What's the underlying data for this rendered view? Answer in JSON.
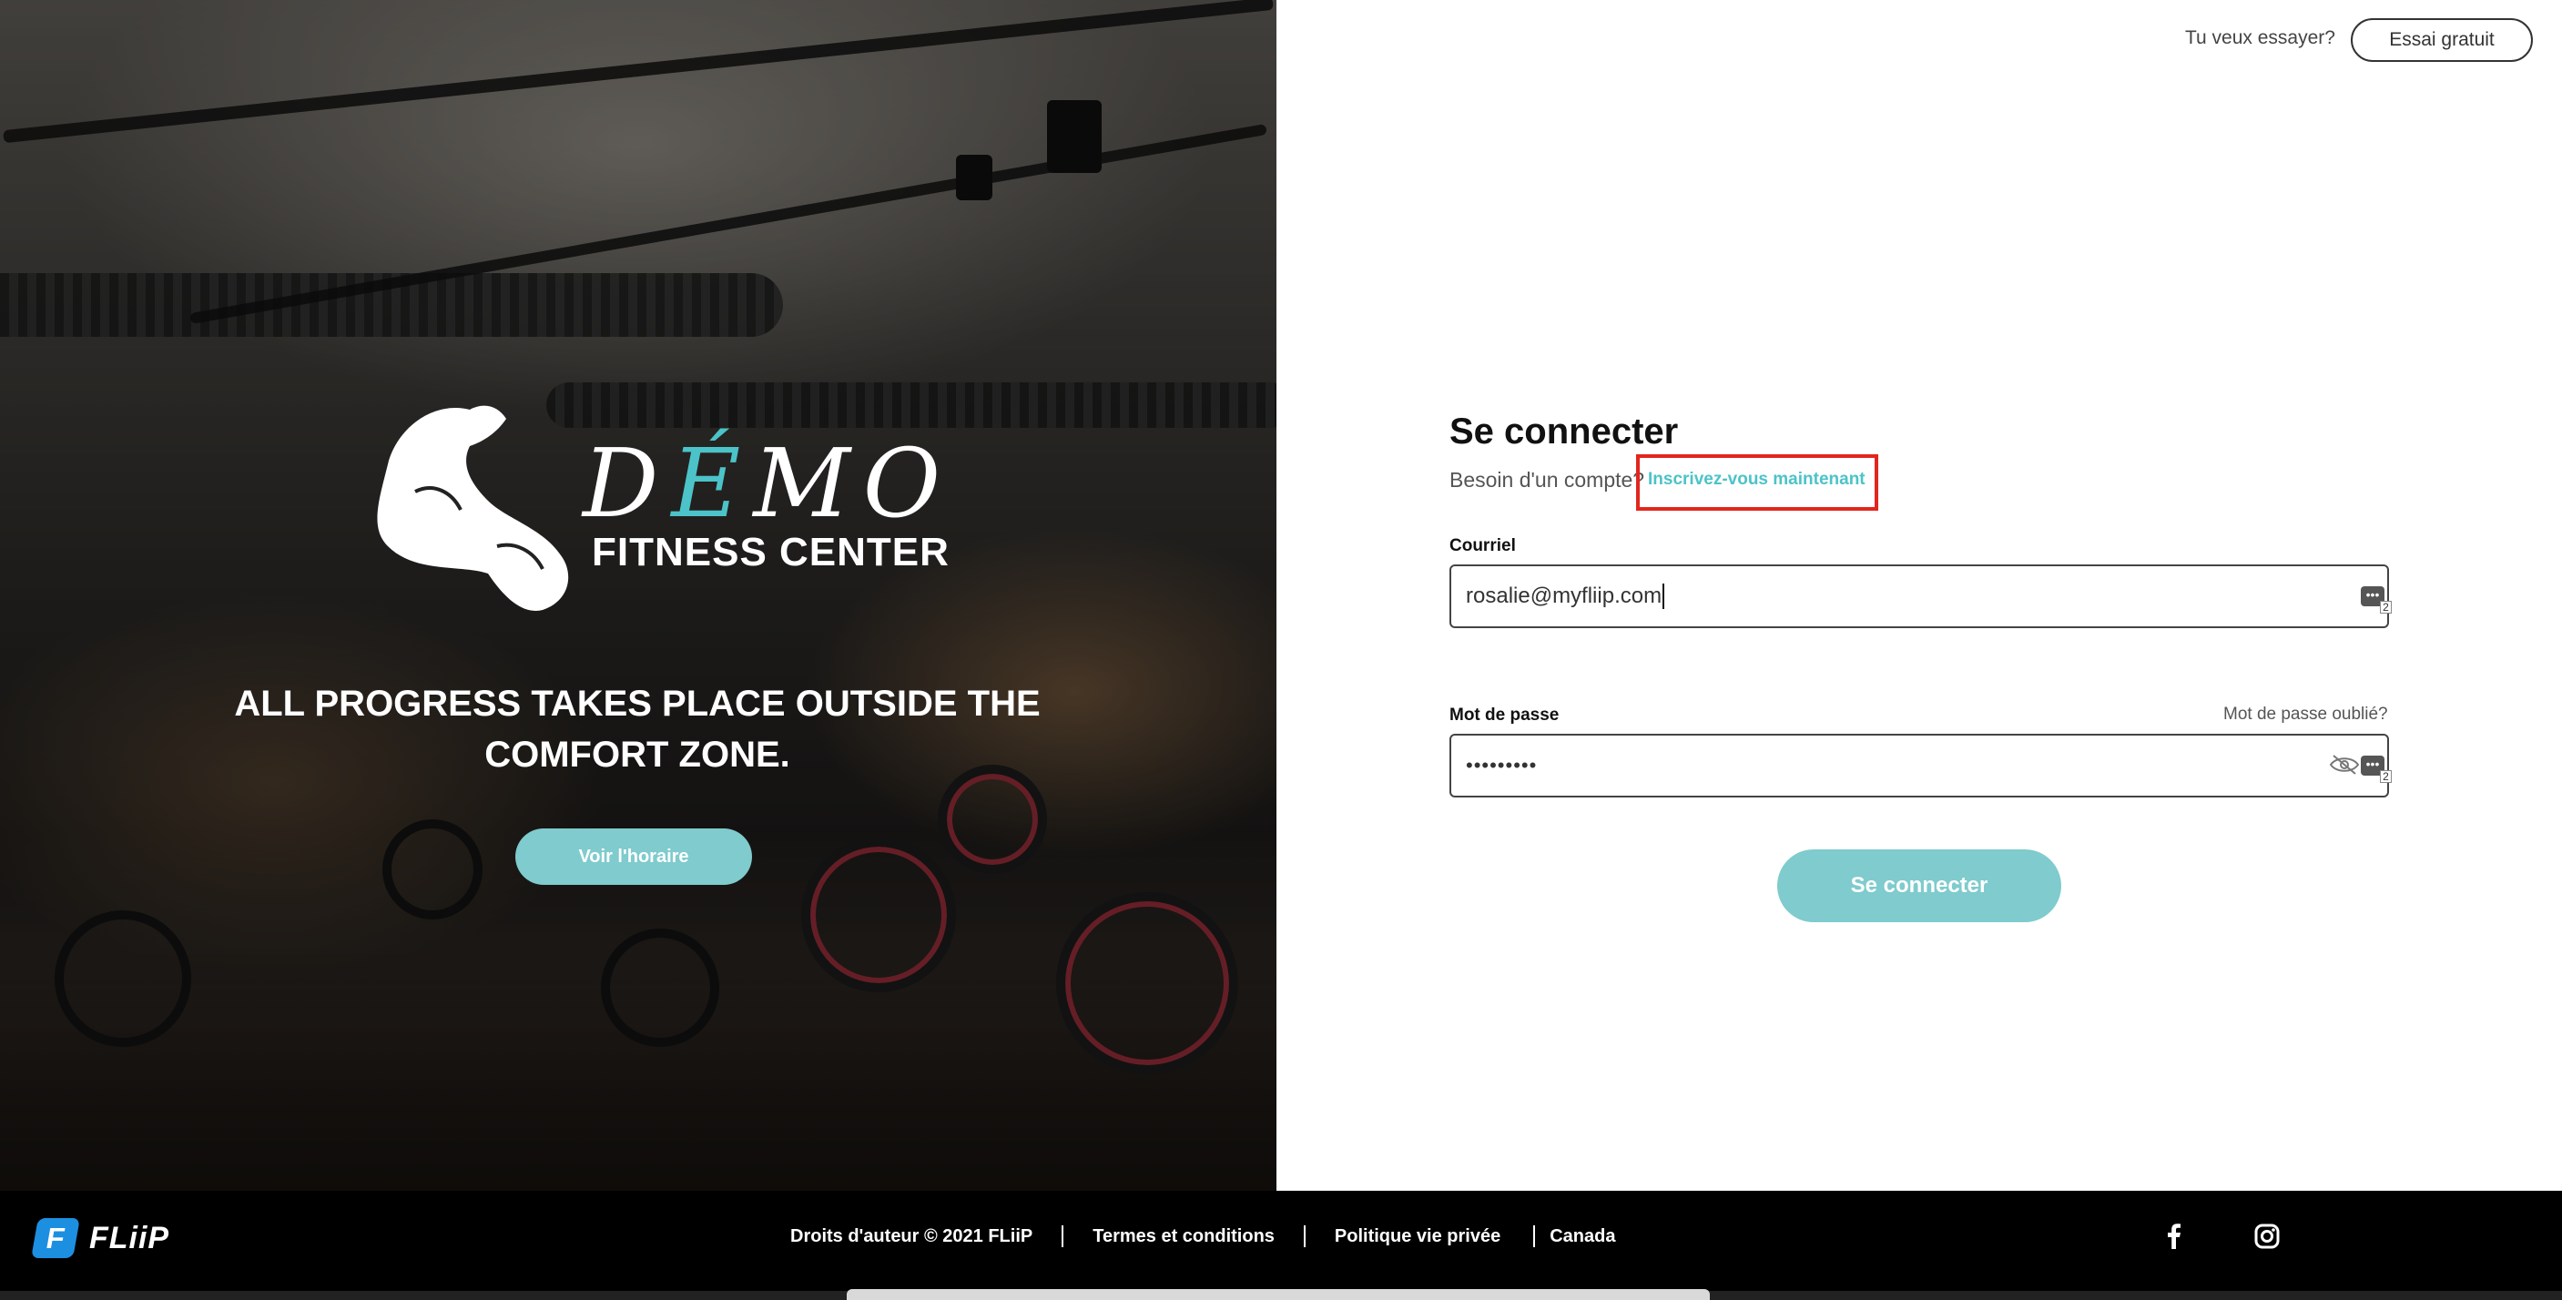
{
  "hero": {
    "brand_name_pre": "D",
    "brand_name_accent": "É",
    "brand_name_post": "MO",
    "brand_subtitle": "FITNESS CENTER",
    "slogan": "ALL PROGRESS TAKES PLACE OUTSIDE THE COMFORT ZONE.",
    "schedule_button": "Voir l'horaire"
  },
  "top_bar": {
    "try_text": "Tu veux essayer?",
    "trial_button": "Essai gratuit"
  },
  "login": {
    "title": "Se connecter",
    "need_account": "Besoin d'un compte?",
    "signup_link": "Inscrivez-vous maintenant",
    "email_label": "Courriel",
    "email_value": "rosalie@myfliip.com",
    "password_label": "Mot de passe",
    "password_value": "•••••••••",
    "forgot_link": "Mot de passe oublié?",
    "submit_button": "Se connecter",
    "autofill_count": "2"
  },
  "footer": {
    "logo_text": "FLiiP",
    "copyright": "Droits d'auteur © 2021 FLiiP",
    "terms": "Termes et conditions",
    "privacy": "Politique vie privée",
    "region": "Canada",
    "icons": [
      "facebook-icon",
      "instagram-icon"
    ]
  },
  "colors": {
    "accent": "#4cc3c8",
    "button": "#7fcbcd",
    "highlight": "#e2261d"
  }
}
